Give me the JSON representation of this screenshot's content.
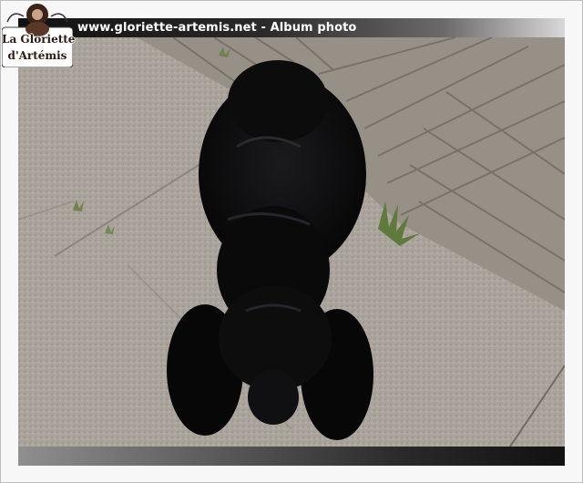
{
  "header": {
    "title": "www.gloriette-artemis.net - Album photo"
  },
  "logo": {
    "line1": "La Gloriette",
    "line2": "d'Artémis"
  },
  "photo": {
    "subject": "black dog lying on paving next to wooden decking tiles",
    "colors": {
      "paving": "#a9a39b",
      "wood": "#9a9186",
      "dog": "#0b0b0c",
      "grass": "#5f7a3c"
    }
  }
}
